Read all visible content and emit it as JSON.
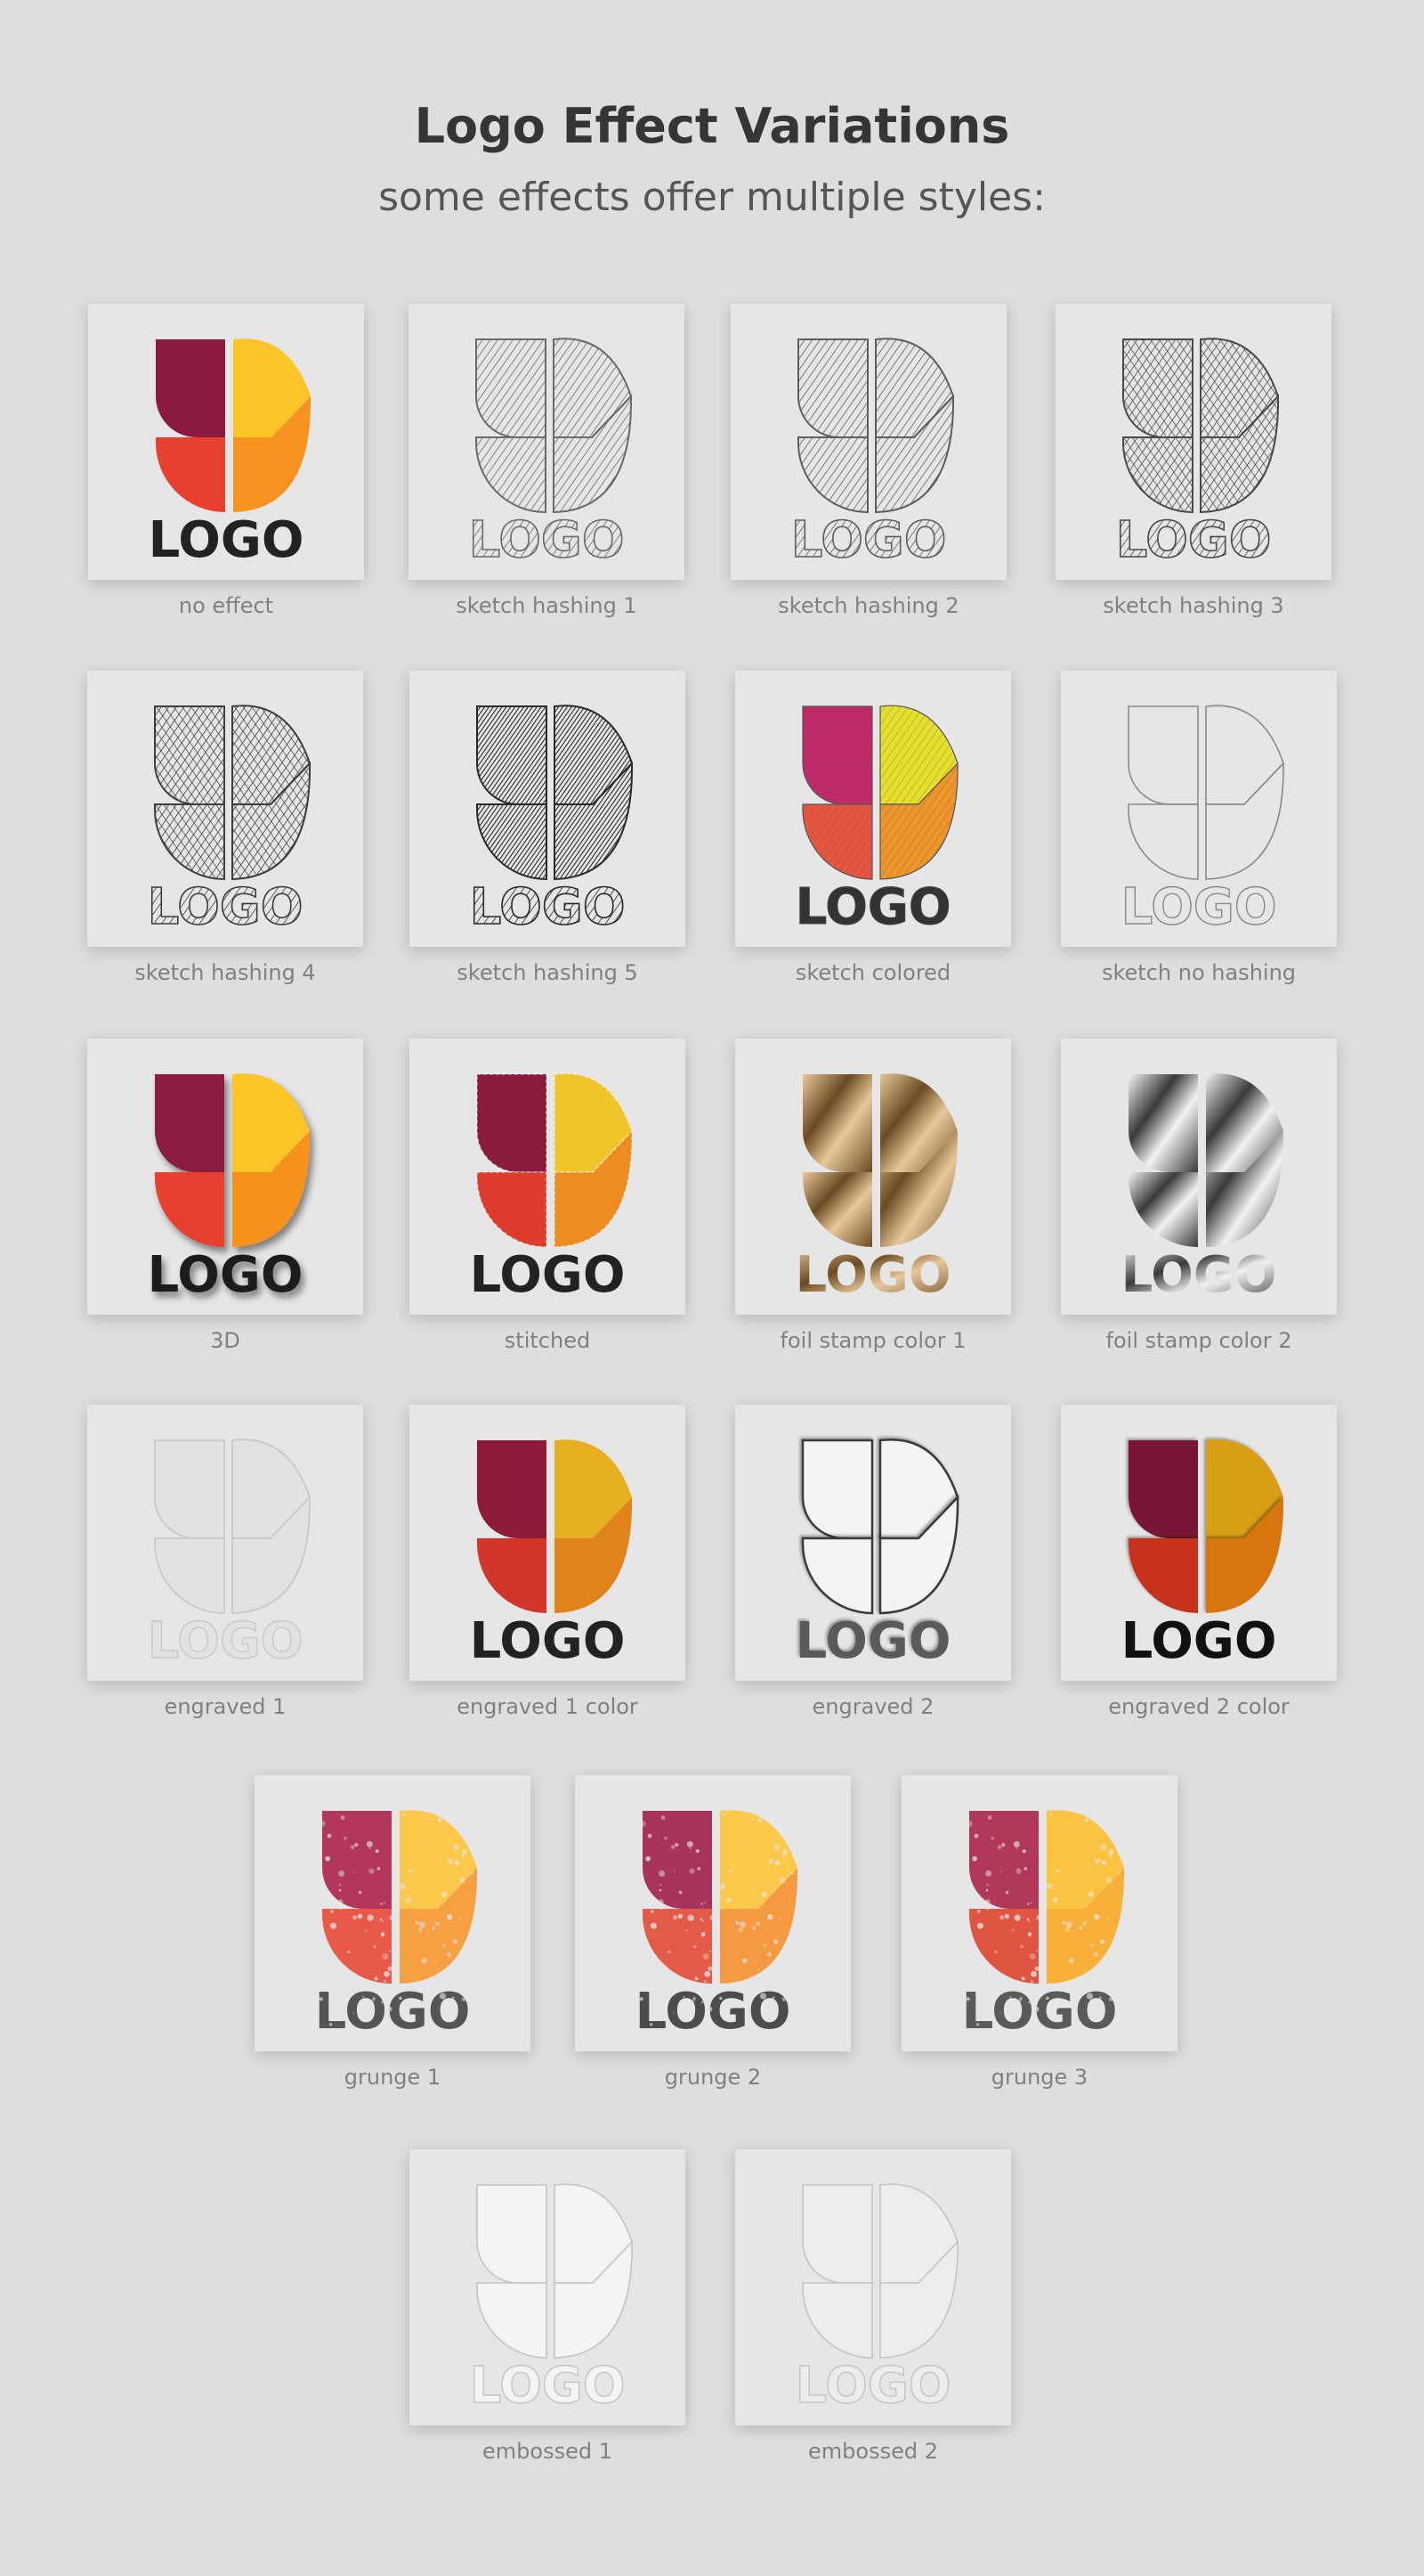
{
  "header": {
    "title": "Logo Effect Variations",
    "subtitle": "some effects offer multiple styles:"
  },
  "logo_text": "LOGO",
  "tiles": [
    {
      "caption": "no effect",
      "style": "color",
      "colors": {
        "tl": "#8c1a40",
        "bl": "#e8402e",
        "tr": "#fdc427",
        "br": "#f6921e",
        "text": "#222222"
      }
    },
    {
      "caption": "sketch hashing 1",
      "style": "sketch",
      "ink": "#6a6a6a",
      "hatch": "light"
    },
    {
      "caption": "sketch hashing 2",
      "style": "sketch",
      "ink": "#5e5e5e",
      "hatch": "light"
    },
    {
      "caption": "sketch hashing 3",
      "style": "sketch",
      "ink": "#4a4a4a",
      "hatch": "medium"
    },
    {
      "caption": "sketch hashing 4",
      "style": "sketch",
      "ink": "#3e3e3e",
      "hatch": "cross"
    },
    {
      "caption": "sketch hashing 5",
      "style": "sketch",
      "ink": "#2a2a2a",
      "hatch": "dense"
    },
    {
      "caption": "sketch colored",
      "style": "sketch-color",
      "colors": {
        "tl": "#c2286a",
        "bl": "#e8553e",
        "tr": "#e6df2e",
        "br": "#f0952a",
        "text": "#333333"
      }
    },
    {
      "caption": "sketch no hashing",
      "style": "outline",
      "ink": "#8a8a8a"
    },
    {
      "caption": "3D",
      "style": "3d",
      "colors": {
        "tl": "#8c1a40",
        "bl": "#e8402e",
        "tr": "#fdc427",
        "br": "#f6921e",
        "text": "#1e1e1e"
      }
    },
    {
      "caption": "stitched",
      "style": "stitched",
      "colors": {
        "tl": "#8a1b3d",
        "bl": "#de3c2c",
        "tr": "#eec62a",
        "br": "#ee8c22",
        "text": "#222222"
      }
    },
    {
      "caption": "foil stamp color 1",
      "style": "foil",
      "colors": {
        "dark": "#6b4a22",
        "light": "#e8c89a"
      }
    },
    {
      "caption": "foil stamp color 2",
      "style": "foil",
      "colors": {
        "dark": "#3a3a3a",
        "light": "#f2f2f2"
      }
    },
    {
      "caption": "engraved 1",
      "style": "engraved-light",
      "ink": "#c9c9c9"
    },
    {
      "caption": "engraved 1 color",
      "style": "color",
      "colors": {
        "tl": "#8c1a38",
        "bl": "#d2352a",
        "tr": "#e6b020",
        "br": "#e2821a",
        "text": "#222222"
      }
    },
    {
      "caption": "engraved 2",
      "style": "engraved-dark",
      "ink": "#3a3a3a"
    },
    {
      "caption": "engraved 2 color",
      "style": "engraved-color",
      "colors": {
        "tl": "#7a1434",
        "bl": "#c8301e",
        "tr": "#d89e14",
        "br": "#d8760e",
        "text": "#111111"
      }
    },
    {
      "caption": "grunge 1",
      "style": "grunge",
      "colors": {
        "tl": "#b3375a",
        "bl": "#e9594a",
        "tr": "#fbc84a",
        "br": "#f6a043",
        "text": "#555555"
      }
    },
    {
      "caption": "grunge 2",
      "style": "grunge",
      "colors": {
        "tl": "#a8345a",
        "bl": "#e45a48",
        "tr": "#fbc84a",
        "br": "#f59a40",
        "text": "#4c4c4c"
      }
    },
    {
      "caption": "grunge 3",
      "style": "grunge",
      "colors": {
        "tl": "#b23858",
        "bl": "#e05442",
        "tr": "#fbc440",
        "br": "#f8b038",
        "text": "#5a5a5a"
      }
    },
    {
      "caption": "embossed 1",
      "style": "embossed",
      "ink": "#f4f4f4"
    },
    {
      "caption": "embossed 2",
      "style": "embossed",
      "ink": "#ededed"
    }
  ]
}
